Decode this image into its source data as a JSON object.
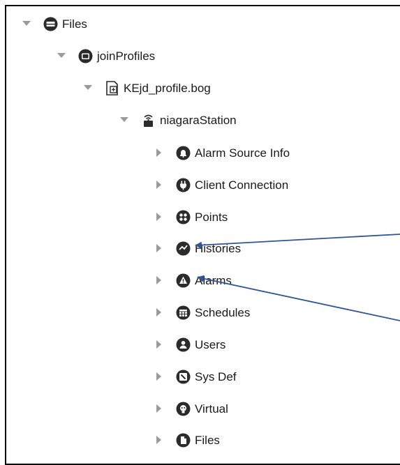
{
  "tree": {
    "files_root": {
      "label": "Files",
      "icon": "drive-icon",
      "expanded": true
    },
    "join_profiles": {
      "label": "joinProfiles",
      "icon": "folder-icon",
      "expanded": true
    },
    "bog_file": {
      "label": "KEjd_profile.bog",
      "icon": "bog-file-icon",
      "expanded": true
    },
    "station": {
      "label": "niagaraStation",
      "icon": "station-icon",
      "expanded": true
    },
    "children": [
      {
        "label": "Alarm Source Info",
        "icon": "bell-icon"
      },
      {
        "label": "Client Connection",
        "icon": "plug-icon"
      },
      {
        "label": "Points",
        "icon": "points-icon"
      },
      {
        "label": "Histories",
        "icon": "history-icon"
      },
      {
        "label": "Alarms",
        "icon": "alarm-icon"
      },
      {
        "label": "Schedules",
        "icon": "calendar-icon"
      },
      {
        "label": "Users",
        "icon": "user-icon"
      },
      {
        "label": "Sys Def",
        "icon": "sysdef-icon"
      },
      {
        "label": "Virtual",
        "icon": "virtual-icon"
      },
      {
        "label": "Files",
        "icon": "file-icon"
      }
    ]
  },
  "colors": {
    "icon_fill": "#2b2b2b",
    "toggle": "#9a9a9a",
    "annotation_arrow": "#2f5597"
  }
}
